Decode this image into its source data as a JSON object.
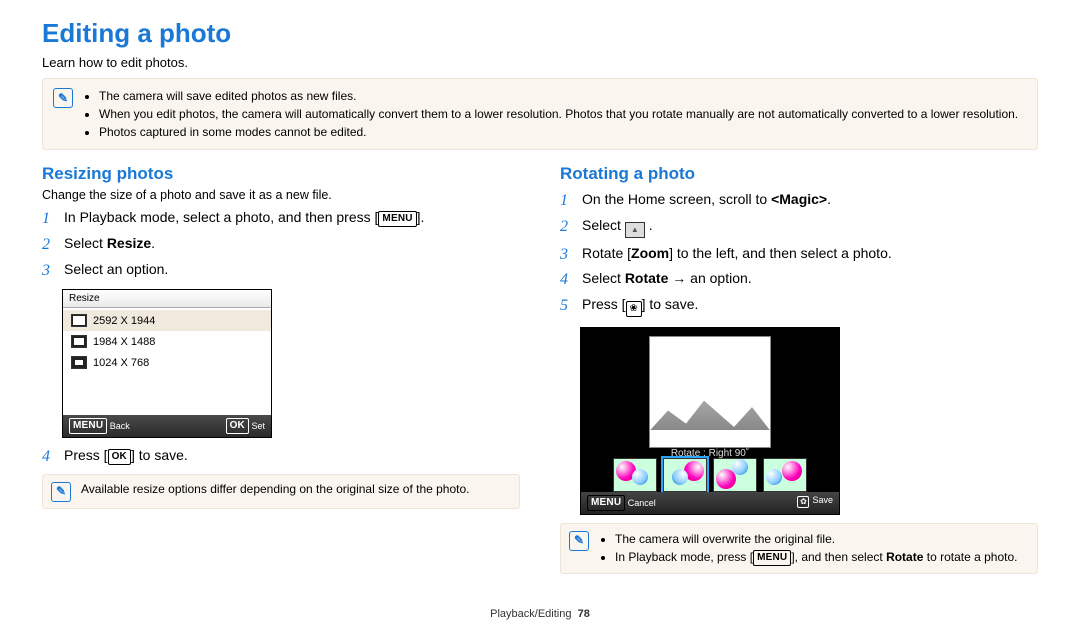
{
  "title": "Editing a photo",
  "subtitle": "Learn how to edit photos.",
  "top_notes": [
    "The camera will save edited photos as new files.",
    "When you edit photos, the camera will automatically convert them to a lower resolution. Photos that you rotate manually are not automatically converted to a lower resolution.",
    "Photos captured in some modes cannot be edited."
  ],
  "left": {
    "heading": "Resizing photos",
    "intro": "Change the size of a photo and save it as a new file.",
    "steps": {
      "s1_pre": "In Playback mode, select a photo, and then press [",
      "s1_btn": "MENU",
      "s1_post": "].",
      "s2_pre": "Select ",
      "s2_bold": "Resize",
      "s2_post": ".",
      "s3": "Select an option.",
      "s4_pre": "Press [",
      "s4_btn": "OK",
      "s4_post": "] to save."
    },
    "menu": {
      "title": "Resize",
      "opts": [
        "2592 X 1944",
        "1984 X 1488",
        "1024 X 768"
      ],
      "back_btn": "MENU",
      "back_label": "Back",
      "set_btn": "OK",
      "set_label": "Set"
    },
    "note": "Available resize options differ depending on the original size of the photo."
  },
  "right": {
    "heading": "Rotating a photo",
    "steps": {
      "s1_pre": "On the Home screen, scroll to ",
      "s1_bold": "<Magic>",
      "s1_post": ".",
      "s2": "Select ",
      "s3_pre": "Rotate [",
      "s3_bold": "Zoom",
      "s3_post": "] to the left, and then select a photo.",
      "s4_pre": "Select ",
      "s4_bold": "Rotate",
      "s4_post": " → an option.",
      "s5_pre": "Press [",
      "s5_post": "] to save."
    },
    "shot": {
      "label": "Rotate : Right 90˚",
      "cancel_btn": "MENU",
      "cancel_label": "Cancel",
      "save_label": "Save"
    },
    "notes": [
      "The camera will overwrite the original file."
    ],
    "note2_pre": "In Playback mode, press [",
    "note2_btn": "MENU",
    "note2_mid": "], and then select ",
    "note2_bold": "Rotate",
    "note2_post": " to rotate a photo."
  },
  "footer": {
    "section": "Playback/Editing",
    "page": "78"
  }
}
